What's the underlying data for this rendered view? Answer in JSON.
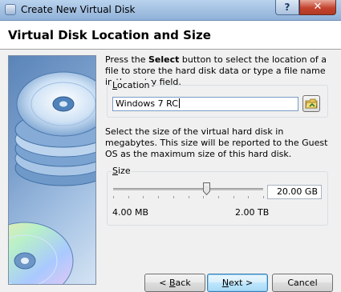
{
  "window": {
    "title": "Create New Virtual Disk",
    "help_label": "?",
    "close_label": "✕"
  },
  "header": {
    "title": "Virtual Disk Location and Size"
  },
  "description": {
    "before": "Press the ",
    "bold": "Select",
    "after": " button to select the location of a file to store the hard disk data or type a file name in the entry field."
  },
  "location": {
    "group_label_mnemonic": "L",
    "group_label_rest": "ocation",
    "value": "Windows 7 RC"
  },
  "size_description": "Select the size of the virtual hard disk in megabytes. This size will be reported to the Guest OS as the maximum size of this hard disk.",
  "size": {
    "group_label_mnemonic": "S",
    "group_label_rest": "ize",
    "min_label": "4.00 MB",
    "max_label": "2.00 TB",
    "value": "20.00 GB",
    "slider_fraction": 0.62
  },
  "buttons": {
    "back_mnemonic": "B",
    "back_prefix": "< ",
    "back_rest": "ack",
    "next_mnemonic": "N",
    "next_rest": "ext",
    "next_suffix": " >",
    "cancel_label": "Cancel"
  },
  "icons": {
    "app": "virtualbox-icon",
    "browse": "folder-browse-icon",
    "art": "disk-stack-icon"
  }
}
